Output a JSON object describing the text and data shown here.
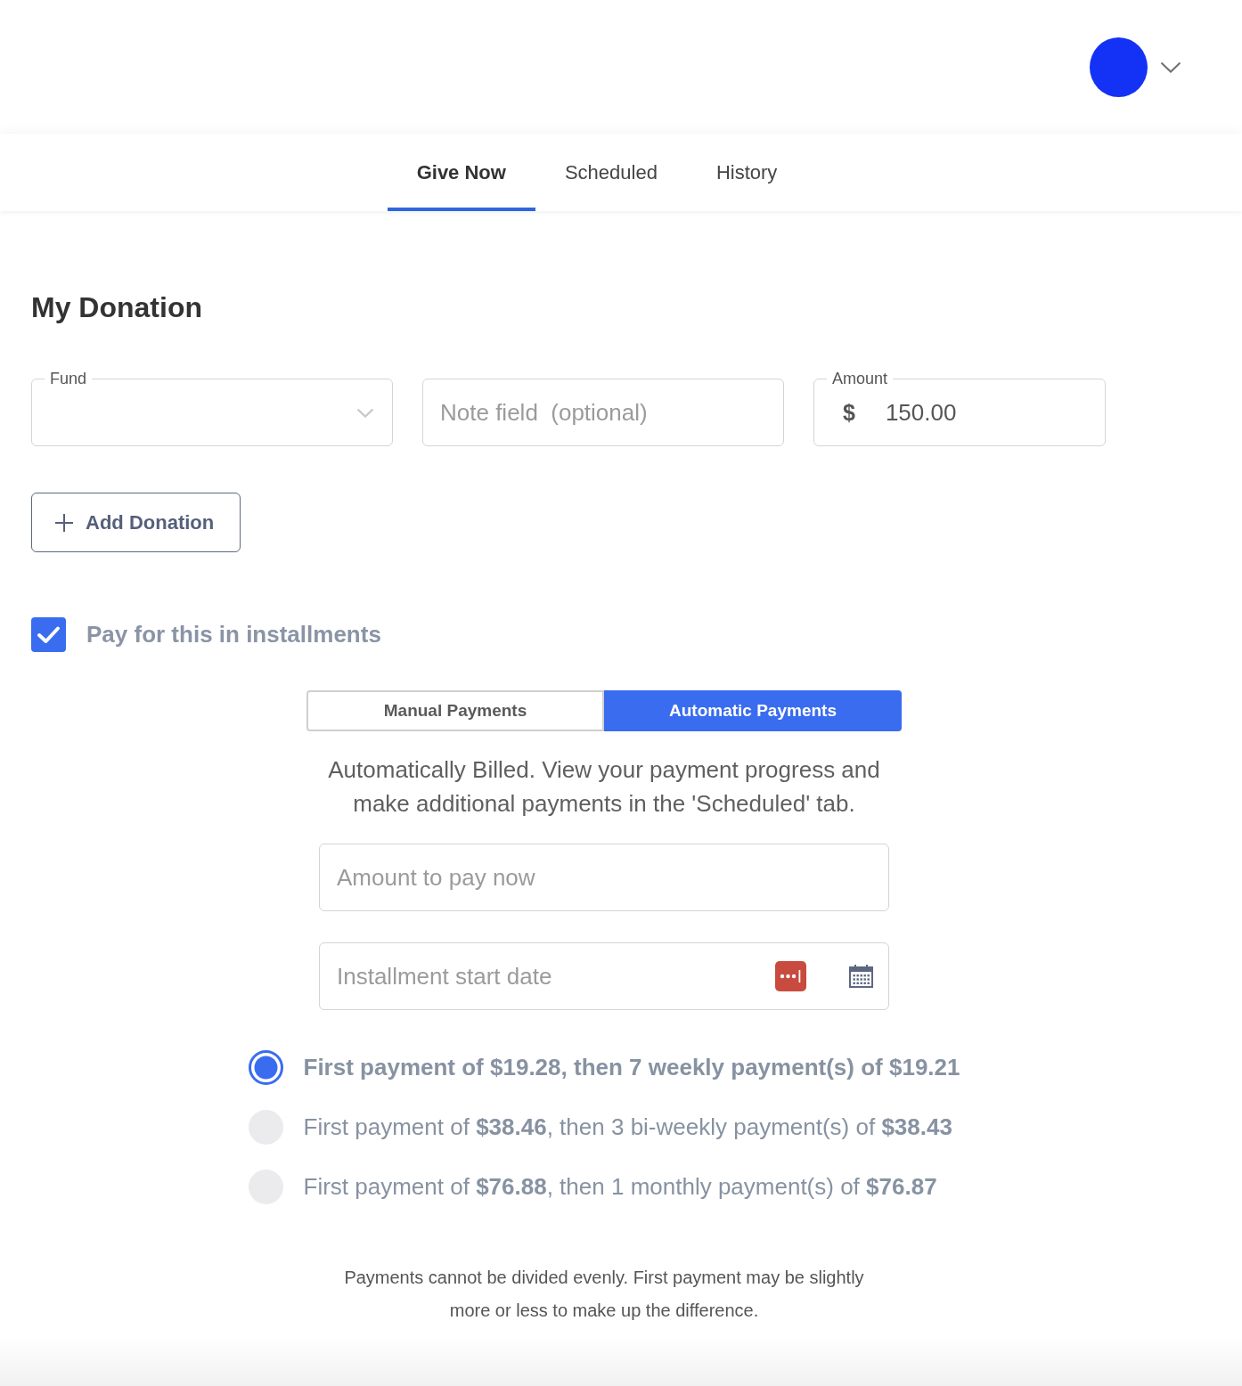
{
  "tabs": [
    {
      "label": "Give Now",
      "selected": true
    },
    {
      "label": "Scheduled",
      "selected": false
    },
    {
      "label": "History",
      "selected": false
    }
  ],
  "title": "My Donation",
  "fund": {
    "label": "Fund"
  },
  "note": {
    "placeholder": "Note field  (optional)"
  },
  "amount": {
    "label": "Amount",
    "currency": "$",
    "value": "150.00"
  },
  "add_button": "Add Donation",
  "installments": {
    "label": "Pay for this in installments",
    "checked": true
  },
  "payment_modes": [
    {
      "label": "Manual Payments",
      "selected": false
    },
    {
      "label": "Automatic Payments",
      "selected": true
    }
  ],
  "description": "Automatically Billed. View your payment progress and make additional payments in the 'Scheduled' tab.",
  "amount_now": {
    "placeholder": "Amount to pay now"
  },
  "start_date": {
    "placeholder": "Installment start date"
  },
  "plans": [
    {
      "text": "First payment of **$19.28**, then 7 weekly payment(s) of **$19.21**",
      "selected": true
    },
    {
      "text": "First payment of **$38.46**, then 3 bi-weekly payment(s) of **$38.43**",
      "selected": false
    },
    {
      "text": "First payment of **$76.88**, then 1 monthly payment(s) of **$76.87**",
      "selected": false
    }
  ],
  "footnote": "Payments cannot be divided evenly. First payment may be slightly more or less to make up the difference."
}
